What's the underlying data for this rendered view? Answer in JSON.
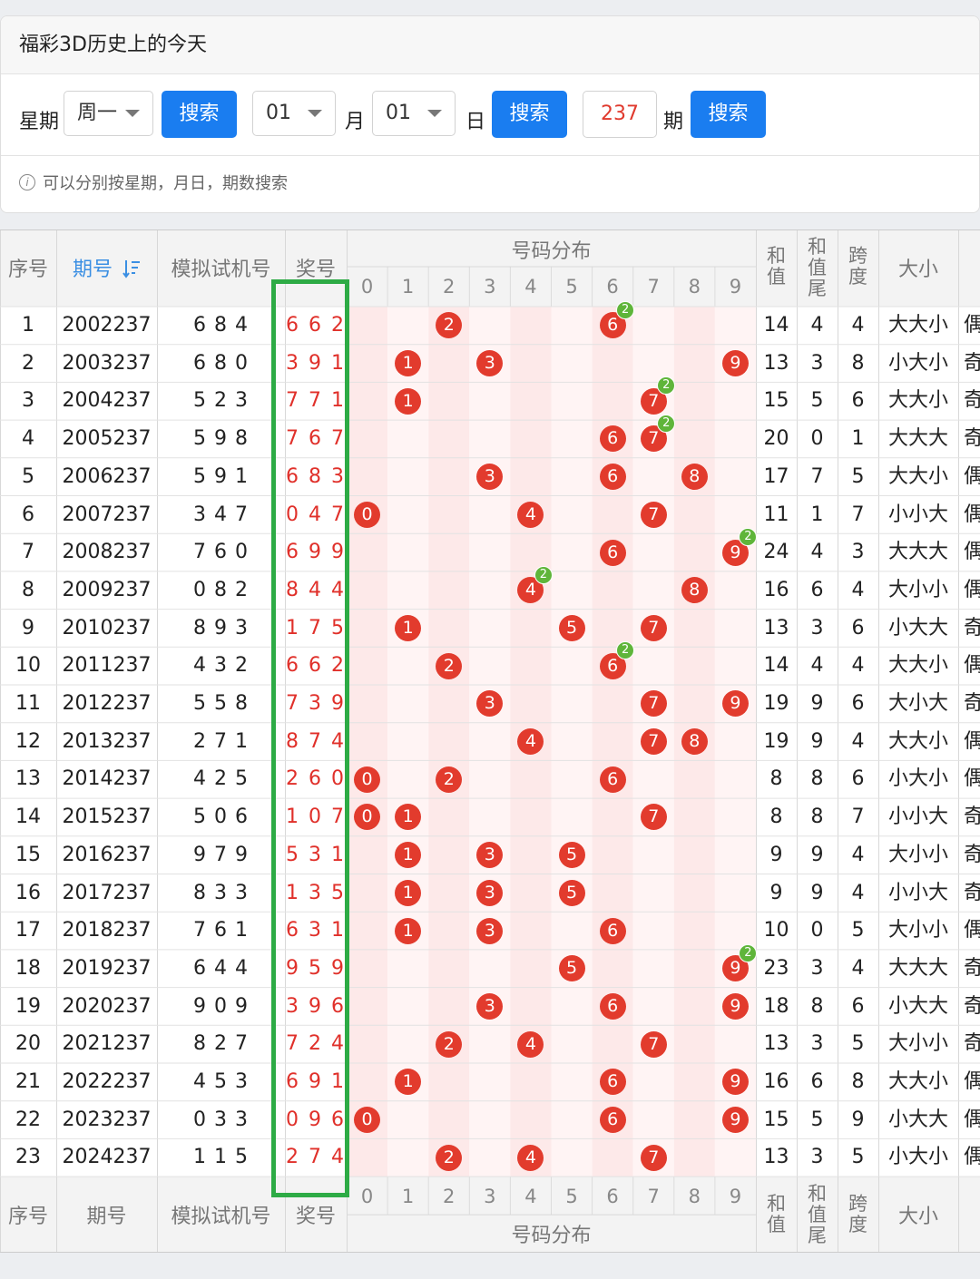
{
  "search": {
    "title": "福彩3D历史上的今天",
    "weekday_label": "星期",
    "weekday_value": "周一",
    "search_label": "搜索",
    "month_value": "01",
    "month_label": "月",
    "day_value": "01",
    "day_label": "日",
    "issue_value": "237",
    "issue_label": "期",
    "tip": "可以分别按星期，月日，期数搜索"
  },
  "table": {
    "headers": {
      "seq": "序号",
      "issue": "期号",
      "sort_icon": "sort-icon",
      "sim": "模拟试机号",
      "prize": "奖号",
      "dist": "号码分布",
      "sum": "和值",
      "sum_tail": "和值尾",
      "span": "跨度",
      "size": "大小"
    },
    "digit_headers": [
      "0",
      "1",
      "2",
      "3",
      "4",
      "5",
      "6",
      "7",
      "8",
      "9"
    ],
    "rows": [
      {
        "seq": "1",
        "issue": "2002237",
        "sim": "6 8 4",
        "prize": "6 6 2",
        "sum": "14",
        "tail": "4",
        "span": "4",
        "size": "大大小",
        "parity": "偶"
      },
      {
        "seq": "2",
        "issue": "2003237",
        "sim": "6 8 0",
        "prize": "3 9 1",
        "sum": "13",
        "tail": "3",
        "span": "8",
        "size": "小大小",
        "parity": "奇"
      },
      {
        "seq": "3",
        "issue": "2004237",
        "sim": "5 2 3",
        "prize": "7 7 1",
        "sum": "15",
        "tail": "5",
        "span": "6",
        "size": "大大小",
        "parity": "奇"
      },
      {
        "seq": "4",
        "issue": "2005237",
        "sim": "5 9 8",
        "prize": "7 6 7",
        "sum": "20",
        "tail": "0",
        "span": "1",
        "size": "大大大",
        "parity": "奇"
      },
      {
        "seq": "5",
        "issue": "2006237",
        "sim": "5 9 1",
        "prize": "6 8 3",
        "sum": "17",
        "tail": "7",
        "span": "5",
        "size": "大大小",
        "parity": "偶"
      },
      {
        "seq": "6",
        "issue": "2007237",
        "sim": "3 4 7",
        "prize": "0 4 7",
        "sum": "11",
        "tail": "1",
        "span": "7",
        "size": "小小大",
        "parity": "偶"
      },
      {
        "seq": "7",
        "issue": "2008237",
        "sim": "7 6 0",
        "prize": "6 9 9",
        "sum": "24",
        "tail": "4",
        "span": "3",
        "size": "大大大",
        "parity": "偶"
      },
      {
        "seq": "8",
        "issue": "2009237",
        "sim": "0 8 2",
        "prize": "8 4 4",
        "sum": "16",
        "tail": "6",
        "span": "4",
        "size": "大小小",
        "parity": "偶"
      },
      {
        "seq": "9",
        "issue": "2010237",
        "sim": "8 9 3",
        "prize": "1 7 5",
        "sum": "13",
        "tail": "3",
        "span": "6",
        "size": "小大大",
        "parity": "奇"
      },
      {
        "seq": "10",
        "issue": "2011237",
        "sim": "4 3 2",
        "prize": "6 6 2",
        "sum": "14",
        "tail": "4",
        "span": "4",
        "size": "大大小",
        "parity": "偶"
      },
      {
        "seq": "11",
        "issue": "2012237",
        "sim": "5 5 8",
        "prize": "7 3 9",
        "sum": "19",
        "tail": "9",
        "span": "6",
        "size": "大小大",
        "parity": "奇"
      },
      {
        "seq": "12",
        "issue": "2013237",
        "sim": "2 7 1",
        "prize": "8 7 4",
        "sum": "19",
        "tail": "9",
        "span": "4",
        "size": "大大小",
        "parity": "偶"
      },
      {
        "seq": "13",
        "issue": "2014237",
        "sim": "4 2 5",
        "prize": "2 6 0",
        "sum": "8",
        "tail": "8",
        "span": "6",
        "size": "小大小",
        "parity": "偶"
      },
      {
        "seq": "14",
        "issue": "2015237",
        "sim": "5 0 6",
        "prize": "1 0 7",
        "sum": "8",
        "tail": "8",
        "span": "7",
        "size": "小小大",
        "parity": "奇"
      },
      {
        "seq": "15",
        "issue": "2016237",
        "sim": "9 7 9",
        "prize": "5 3 1",
        "sum": "9",
        "tail": "9",
        "span": "4",
        "size": "大小小",
        "parity": "奇"
      },
      {
        "seq": "16",
        "issue": "2017237",
        "sim": "8 3 3",
        "prize": "1 3 5",
        "sum": "9",
        "tail": "9",
        "span": "4",
        "size": "小小大",
        "parity": "奇"
      },
      {
        "seq": "17",
        "issue": "2018237",
        "sim": "7 6 1",
        "prize": "6 3 1",
        "sum": "10",
        "tail": "0",
        "span": "5",
        "size": "大小小",
        "parity": "偶"
      },
      {
        "seq": "18",
        "issue": "2019237",
        "sim": "6 4 4",
        "prize": "9 5 9",
        "sum": "23",
        "tail": "3",
        "span": "4",
        "size": "大大大",
        "parity": "奇"
      },
      {
        "seq": "19",
        "issue": "2020237",
        "sim": "9 0 9",
        "prize": "3 9 6",
        "sum": "18",
        "tail": "8",
        "span": "6",
        "size": "小大大",
        "parity": "奇"
      },
      {
        "seq": "20",
        "issue": "2021237",
        "sim": "8 2 7",
        "prize": "7 2 4",
        "sum": "13",
        "tail": "3",
        "span": "5",
        "size": "大小小",
        "parity": "奇"
      },
      {
        "seq": "21",
        "issue": "2022237",
        "sim": "4 5 3",
        "prize": "6 9 1",
        "sum": "16",
        "tail": "6",
        "span": "8",
        "size": "大大小",
        "parity": "偶"
      },
      {
        "seq": "22",
        "issue": "2023237",
        "sim": "0 3 3",
        "prize": "0 9 6",
        "sum": "15",
        "tail": "5",
        "span": "9",
        "size": "小大大",
        "parity": "偶"
      },
      {
        "seq": "23",
        "issue": "2024237",
        "sim": "1 1 5",
        "prize": "2 7 4",
        "sum": "13",
        "tail": "3",
        "span": "5",
        "size": "小大小",
        "parity": "偶"
      }
    ],
    "colors": {
      "ball": "#e23b2d",
      "badge": "#5fb53a",
      "highlight_box": "#2dab45",
      "link": "#3b8fe3",
      "prize_text": "#e0302a",
      "dist_band": "#fde9e9"
    }
  }
}
